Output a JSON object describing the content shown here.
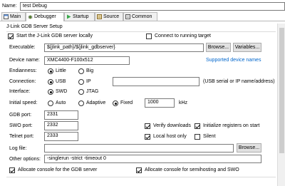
{
  "name_label": "Name:",
  "name_value": "test Debug",
  "tabs": [
    {
      "label": "Main",
      "icon": "main-icon"
    },
    {
      "label": "Debugger",
      "icon": "debugger-icon"
    },
    {
      "label": "Startup",
      "icon": "startup-icon"
    },
    {
      "label": "Source",
      "icon": "source-icon"
    },
    {
      "label": "Common",
      "icon": "common-icon"
    }
  ],
  "section_title": "J-Link GDB Server Setup",
  "start_server_label": "Start the J-Link GDB server locally",
  "connect_running_label": "Connect to running target",
  "executable_label": "Executable:",
  "executable_value": "${jlink_path}/${jlink_gdbserver}",
  "browse_label": "Browse...",
  "variables_label": "Variables...",
  "device_label": "Device name:",
  "device_value": "XMC4400-F100x512",
  "supported_devices_label": "Supported device names",
  "endianness_label": "Endianness:",
  "little_label": "Little",
  "big_label": "Big",
  "connection_label": "Connection:",
  "usb_label": "USB",
  "ip_label": "IP",
  "usb_hint": "(USB serial or IP name/address)",
  "interface_label": "Interface:",
  "swd_label": "SWD",
  "jtag_label": "JTAG",
  "speed_label": "Initial speed:",
  "auto_label": "Auto",
  "adaptive_label": "Adaptive",
  "fixed_label": "Fixed",
  "speed_value": "1000",
  "speed_unit": "kHz",
  "gdb_port_label": "GDB port:",
  "gdb_port_value": "2331",
  "swo_port_label": "SWO port:",
  "swo_port_value": "2332",
  "telnet_port_label": "Telnet port:",
  "telnet_port_value": "2333",
  "verify_label": "Verify downloads",
  "init_regs_label": "Initialize registers on start",
  "local_host_label": "Local host only",
  "silent_label": "Silent",
  "log_file_label": "Log file:",
  "log_browse_label": "Browse...",
  "other_options_label": "Other options:",
  "other_options_value": "-singlerun -strict -timeout 0",
  "alloc_gdb_label": "Allocate console for the GDB server",
  "alloc_semi_label": "Allocate console for semihosting and SWO"
}
